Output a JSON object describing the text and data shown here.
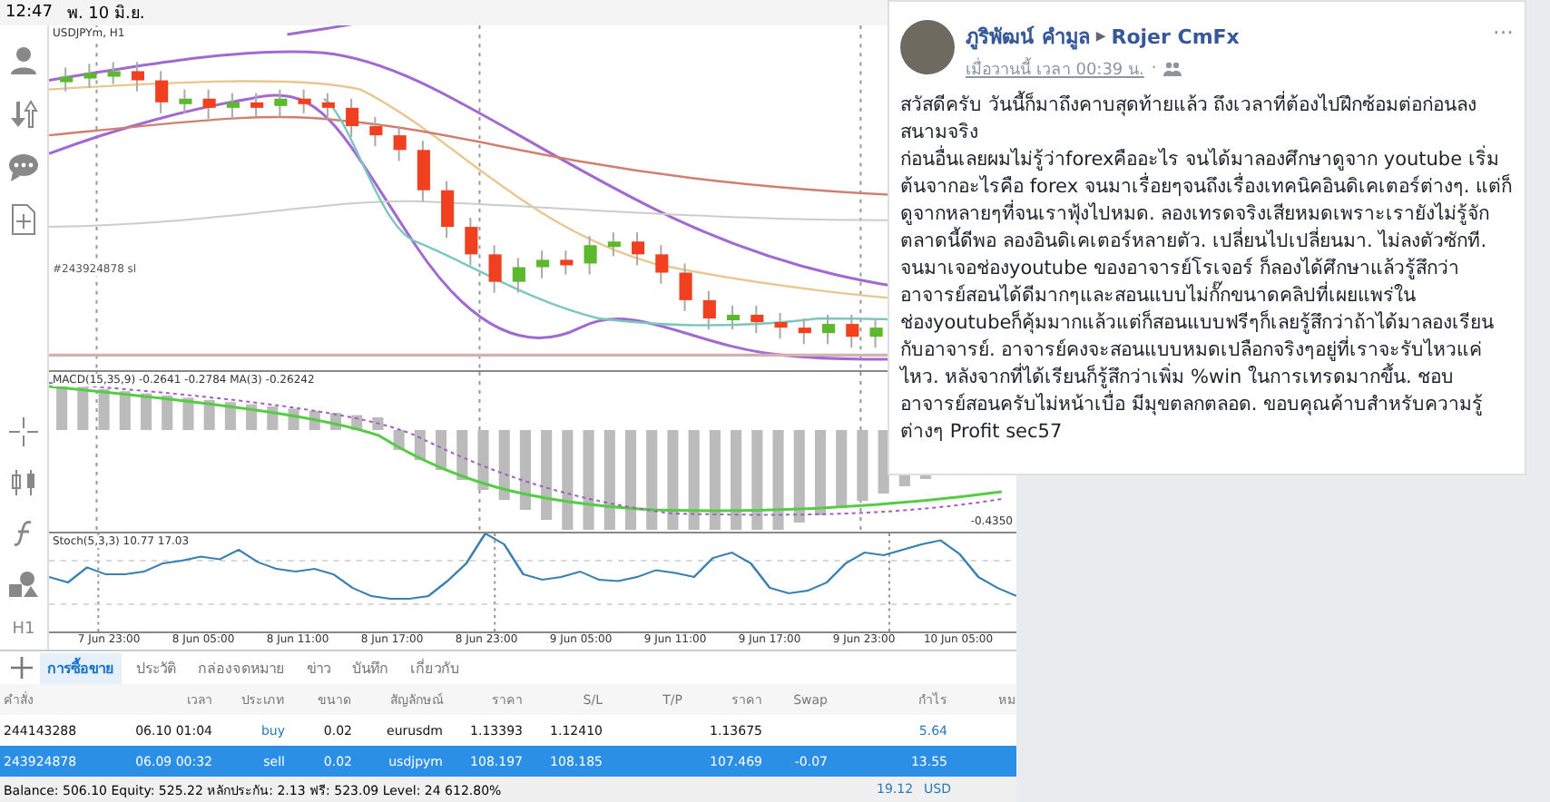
{
  "status_bar": {
    "time": "12:47",
    "date": "พ. 10 มิ.ย."
  },
  "chart": {
    "symbol_label": "USDJPYm, H1",
    "order_label": "#243924878 sl",
    "macd_label": "MACD(15,35,9) -0.2641 -0.2784 MA(3) -0.26242",
    "macd_axis_label": "-0.4350",
    "stoch_label": "Stoch(5,3,3) 10.77 17.03",
    "x_axis_labels": [
      "7 Jun 23:00",
      "8 Jun 05:00",
      "8 Jun 11:00",
      "8 Jun 17:00",
      "8 Jun 23:00",
      "9 Jun 05:00",
      "9 Jun 11:00",
      "9 Jun 17:00",
      "9 Jun 23:00",
      "10 Jun 05:00"
    ]
  },
  "toolbar": {
    "timeframe": "H1"
  },
  "terminal": {
    "tabs": [
      {
        "label": "การซื้อขาย",
        "selected": true
      },
      {
        "label": "ประวัติ",
        "selected": false
      },
      {
        "label": "กล่องจดหมาย",
        "selected": false
      },
      {
        "label": "ข่าว",
        "selected": false
      },
      {
        "label": "บันทึก",
        "selected": false
      },
      {
        "label": "เกี่ยวกับ",
        "selected": false
      }
    ],
    "columns": [
      "คำสั่ง",
      "เวลา",
      "ประเภท",
      "ขนาด",
      "สัญลักษณ์",
      "ราคา",
      "S/L",
      "T/P",
      "ราคา",
      "Swap",
      "กำไร",
      "หม"
    ],
    "rows": [
      {
        "selected": false,
        "cells": [
          "244143288",
          "06.10 01:04",
          "buy",
          "0.02",
          "eurusdm",
          "1.13393",
          "1.12410",
          "",
          "1.13675",
          "",
          "5.64"
        ]
      },
      {
        "selected": true,
        "cells": [
          "243924878",
          "06.09 00:32",
          "sell",
          "0.02",
          "usdjpym",
          "108.197",
          "108.185",
          "",
          "107.469",
          "-0.07",
          "13.55"
        ]
      }
    ],
    "balance": "Balance: 506.10 Equity: 525.22 หลักประกัน: 2.13 ฟรี: 523.09 Level: 24 612.80%",
    "total_profit": "19.12",
    "currency": "USD"
  },
  "post": {
    "author": "ภูริพัฒน์ คำมูล",
    "separator": "▶",
    "target": "Rojer CmFx",
    "time": "เมื่อวานนี้ เวลา 00:39 น.",
    "dot": "·",
    "menu": "···",
    "paragraphs": [
      "สวัสดีครับ วันนี้ก็มาถึงคาบสุดท้ายแล้ว ถึงเวลาที่ต้องไปฝึกซ้อมต่อก่อนลงสนามจริง",
      "ก่อนอื่นเลยผมไม่รู้ว่าforexคืออะไร จนได้มาลองศึกษาดูจาก youtube เริ่มต้นจากอะไรคือ forex จนมาเรื่อยๆจนถึงเรื่องเทคนิคอินดิเคเตอร์ต่างๆ. แต่ก็ดูจากหลายๆที่จนเราฟุ้งไปหมด. ลองเทรดจริงเสียหมดเพราะเรายังไม่รู้จักตลาดนี้ดีพอ ลองอินดิเคเตอร์หลายตัว. เปลี่ยนไปเปลี่ยนมา. ไม่ลงตัวซักที. จนมาเจอช่องyoutube ของอาจารย์โรเจอร์ ก็ลองได้ศึกษาแล้วรู้สึกว่าอาจารย์สอนได้ดีมากๆและสอนแบบไม่กั๊กขนาดคลิปที่เผยแพร่ในช่องyoutubeก็คุ้มมากแล้วแต่ก็สอนแบบฟรีๆก็เลยรู้สึกว่าถ้าได้มาลองเรียนกับอาจารย์. อาจารย์คงจะสอนแบบหมดเปลือกจริงๆอยู่ที่เราจะรับไหวแค่ไหว. หลังจากที่ได้เรียนก็รู้สึกว่าเพิ่ม %win ในการเทรดมากขึ้น. ชอบอาจารย์สอนครับไม่หน้าเบื่อ มีมุขตลกตลอด. ขอบคุณค้าบสำหรับความรู้ต่างๆ Profit sec57"
    ]
  }
}
